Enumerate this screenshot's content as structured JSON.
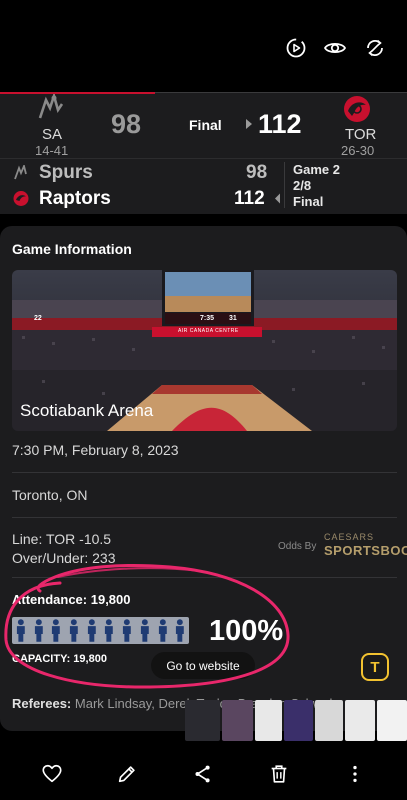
{
  "scoreboard": {
    "away": {
      "abbr": "SA",
      "record": "14-41",
      "score": "98"
    },
    "home": {
      "abbr": "TOR",
      "record": "26-30",
      "score": "112"
    },
    "status": "Final"
  },
  "linescore": {
    "teams": [
      {
        "name": "Spurs",
        "score": "98"
      },
      {
        "name": "Raptors",
        "score": "112"
      }
    ],
    "game_label": "Game 2",
    "game_date": "2/8",
    "game_status": "Final"
  },
  "game_info": {
    "title": "Game Information",
    "arena": "Scotiabank Arena",
    "jumbotron_left": "22",
    "jumbotron_time": "7:35",
    "jumbotron_right": "31",
    "arena_banner": "AIR CANADA CENTRE",
    "datetime": "7:30 PM, February 8, 2023",
    "location": "Toronto, ON",
    "line": "Line: TOR -10.5",
    "over_under": "Over/Under: 233",
    "odds_by": "Odds By",
    "sponsor_top": "CAESARS",
    "sponsor_bottom": "SPORTSBOOK",
    "attendance": "Attendance: 19,800",
    "attendance_percent_value": 100,
    "attendance_percent": "100%",
    "capacity": "CAPACITY: 19,800",
    "referees_label": "Referees:",
    "referees_names": "Mark Lindsay, Derek Taylor, Brandon Schwab"
  },
  "actions": {
    "go_to_website": "Go to website",
    "text_button": "T"
  },
  "colors": {
    "raptors_red": "#c8102e",
    "annotation_pink": "#e8276b",
    "card_bg": "#1c1c1e",
    "sportsbook_gold": "#b59e6c",
    "t_button_yellow": "#f2c230"
  },
  "icons": {
    "top": [
      "motion-photo-icon",
      "eye-icon",
      "rotate-icon"
    ],
    "bottom": [
      "heart-icon",
      "edit-icon",
      "share-icon",
      "trash-icon",
      "more-vertical-icon"
    ]
  }
}
